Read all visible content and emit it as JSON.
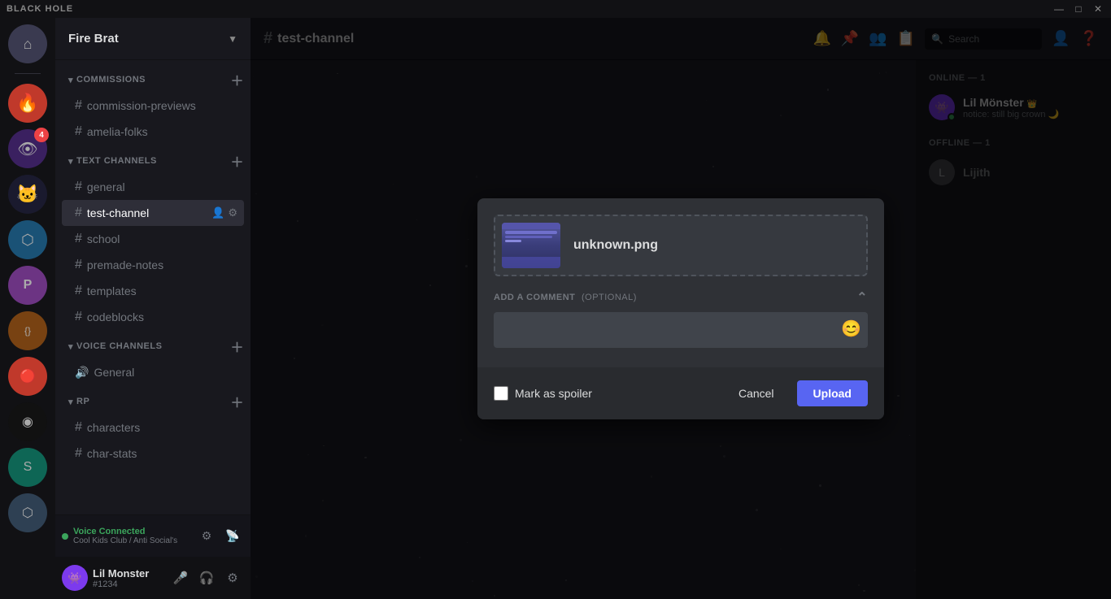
{
  "titleBar": {
    "title": "BLACK HOLE",
    "minimize": "—",
    "maximize": "□",
    "close": "✕"
  },
  "serverSidebar": {
    "icons": [
      {
        "id": "home",
        "label": "Home",
        "glyph": "⌂",
        "colorClass": "home",
        "badge": null
      },
      {
        "id": "server1",
        "label": "Server 1",
        "glyph": "🔥",
        "colorClass": "si-red",
        "badge": null
      },
      {
        "id": "server2",
        "label": "Server 2",
        "glyph": "👁",
        "colorClass": "si-purple",
        "badge": "4"
      },
      {
        "id": "server3",
        "label": "Server 3",
        "glyph": "🐱",
        "colorClass": "si-dark",
        "badge": null
      },
      {
        "id": "server4",
        "label": "Server 4",
        "glyph": "⬡",
        "colorClass": "si-blue",
        "badge": null
      },
      {
        "id": "server5",
        "label": "Server 5",
        "glyph": "P",
        "colorClass": "si-purple",
        "badge": null
      },
      {
        "id": "server6",
        "label": "Server 6",
        "glyph": "{ }",
        "colorClass": "si-orange",
        "badge": null
      },
      {
        "id": "server7",
        "label": "Server 7",
        "glyph": "🔴",
        "colorClass": "si-red",
        "badge": null
      },
      {
        "id": "server8",
        "label": "Server 8",
        "glyph": "◉",
        "colorClass": "si-dark",
        "badge": null
      },
      {
        "id": "server9",
        "label": "Server 9",
        "glyph": "⬡",
        "colorClass": "si-teal",
        "badge": null
      },
      {
        "id": "server10",
        "label": "Server 10",
        "glyph": "S",
        "colorClass": "si-brown",
        "badge": null
      }
    ]
  },
  "channelSidebar": {
    "serverName": "Fire Brat",
    "sections": [
      {
        "name": "COMMISSIONS",
        "channels": [
          {
            "name": "commission-previews",
            "type": "text"
          },
          {
            "name": "amelia-folks",
            "type": "text"
          }
        ]
      },
      {
        "name": "TEXT CHANNELS",
        "channels": [
          {
            "name": "general",
            "type": "text"
          },
          {
            "name": "test-channel",
            "type": "text",
            "active": true
          },
          {
            "name": "school",
            "type": "text"
          },
          {
            "name": "premade-notes",
            "type": "text"
          },
          {
            "name": "templates",
            "type": "text"
          },
          {
            "name": "codeblocks",
            "type": "text"
          }
        ]
      },
      {
        "name": "VOICE CHANNELS",
        "channels": [
          {
            "name": "General",
            "type": "voice"
          }
        ]
      },
      {
        "name": "RP",
        "channels": [
          {
            "name": "characters",
            "type": "text"
          },
          {
            "name": "char-stats",
            "type": "text"
          }
        ]
      }
    ],
    "voiceConnected": {
      "status": "Voice Connected",
      "server": "Cool Kids Club / Anti Social's"
    },
    "currentUser": {
      "name": "Lil Monster",
      "tag": "#1234"
    }
  },
  "topBar": {
    "channelName": "test-channel",
    "topic": ""
  },
  "members": {
    "online": {
      "header": "ONLINE — 1",
      "members": [
        {
          "name": "Lil Mönster",
          "status": "notice: still big crown 🌙",
          "crown": true,
          "online": true,
          "avatarColor": "#8b5cf6"
        }
      ]
    },
    "offline": {
      "header": "OFFLINE — 1",
      "members": [
        {
          "name": "Lijith",
          "status": "",
          "online": false,
          "avatarColor": "#636568"
        }
      ]
    }
  },
  "uploadModal": {
    "filename": "unknown.png",
    "commentLabel": "ADD A COMMENT",
    "commentOptional": "(OPTIONAL)",
    "commentPlaceholder": "",
    "spoilerLabel": "Mark as spoiler",
    "cancelLabel": "Cancel",
    "uploadLabel": "Upload"
  }
}
